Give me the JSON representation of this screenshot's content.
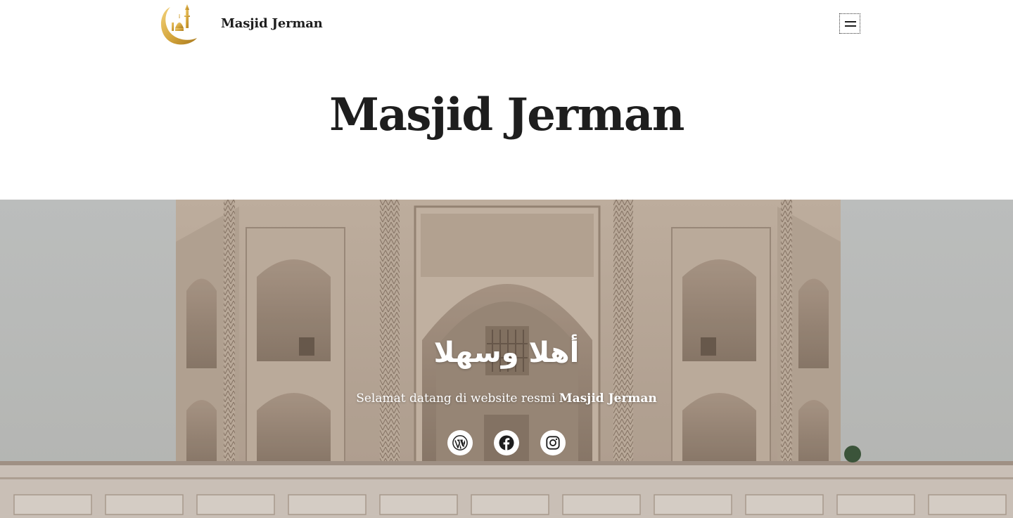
{
  "header": {
    "site_name": "Masjid Jerman",
    "menu_icon": "hamburger-icon",
    "logo_icon": "crescent-mosque-logo"
  },
  "page": {
    "title": "Masjid Jerman"
  },
  "hero": {
    "heading": "أهلا وسهلا",
    "subtitle_prefix": "Selamat datang di website resmi ",
    "subtitle_emphasis": "Masjid Jerman",
    "social": [
      {
        "icon": "wordpress-icon"
      },
      {
        "icon": "facebook-icon"
      },
      {
        "icon": "instagram-icon"
      }
    ]
  },
  "colors": {
    "text": "#1e1e1e",
    "logo_gold": "#d4a53c",
    "hero_text": "#ffffff"
  }
}
